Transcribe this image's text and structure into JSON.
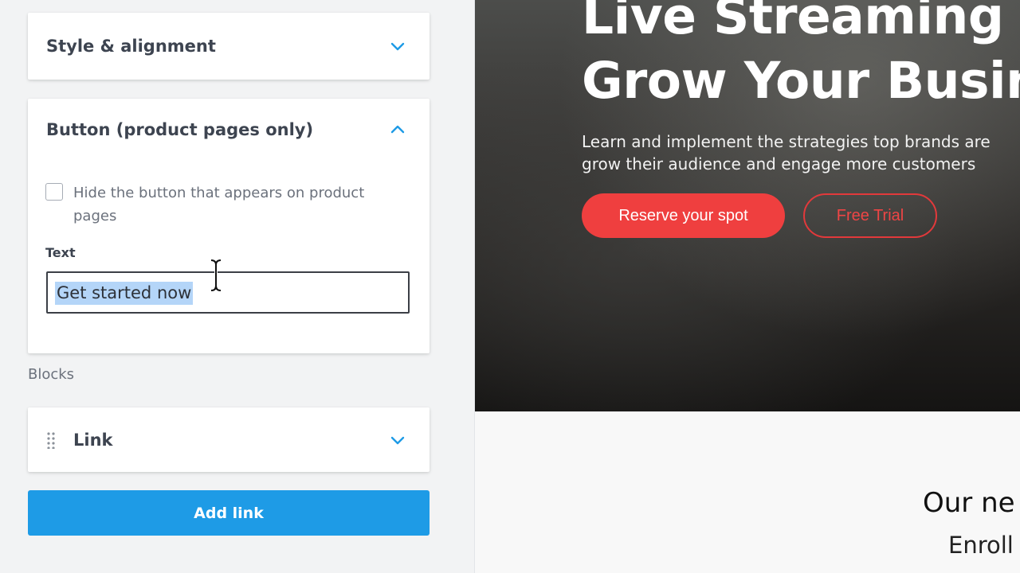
{
  "editor": {
    "style_section": {
      "title": "Style & alignment",
      "expanded": false
    },
    "button_section": {
      "title": "Button (product pages only)",
      "expanded": true,
      "hide_checkbox_label": "Hide the button that appears on product pages",
      "hide_checked": false,
      "text_field_label": "Text",
      "text_field_value": "Get started now"
    },
    "blocks_label": "Blocks",
    "link_block": {
      "title": "Link",
      "expanded": false
    },
    "add_link_label": "Add link",
    "colors": {
      "accent": "#1e9be6",
      "text_dark": "#3d4450",
      "selection": "#b4d5f8"
    }
  },
  "preview": {
    "hero_title_line1": "Live Streaming W",
    "hero_title_line2": "Grow Your Busine",
    "hero_subtitle_line1": "Learn and implement the strategies top brands are",
    "hero_subtitle_line2": "grow their audience and engage more customers",
    "primary_button": "Reserve your spot",
    "secondary_button": "Free Trial",
    "section_heading": "Our ne",
    "section_sub": "Enroll",
    "colors": {
      "primary_button": "#ef3f3f",
      "secondary_border": "#e2393b"
    }
  }
}
